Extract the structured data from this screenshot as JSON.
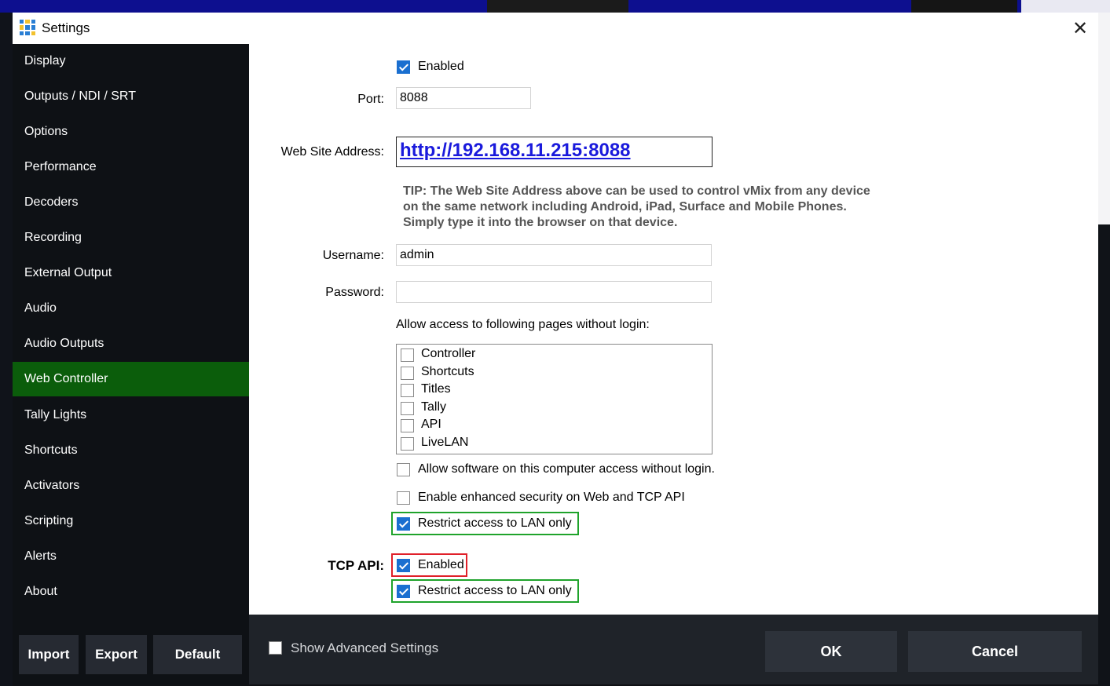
{
  "window": {
    "title": "Settings",
    "close_symbol": "✕"
  },
  "sidebar": {
    "items": [
      {
        "label": "Display"
      },
      {
        "label": "Outputs / NDI / SRT"
      },
      {
        "label": "Options"
      },
      {
        "label": "Performance"
      },
      {
        "label": "Decoders"
      },
      {
        "label": "Recording"
      },
      {
        "label": "External Output"
      },
      {
        "label": "Audio"
      },
      {
        "label": "Audio Outputs"
      },
      {
        "label": "Web Controller",
        "active": true
      },
      {
        "label": "Tally Lights"
      },
      {
        "label": "Shortcuts"
      },
      {
        "label": "Activators"
      },
      {
        "label": "Scripting"
      },
      {
        "label": "Alerts"
      },
      {
        "label": "About"
      }
    ],
    "buttons": {
      "import": "Import",
      "export": "Export",
      "default": "Default"
    }
  },
  "web_controller": {
    "enabled_label": "Enabled",
    "enabled": true,
    "port_label": "Port:",
    "port_value": "8088",
    "website_label": "Web Site Address:",
    "website_url": "http://192.168.11.215:8088",
    "tip_lines": [
      "TIP: The Web Site Address above can be used to control vMix from any device",
      "on the same network including Android, iPad, Surface and Mobile Phones.",
      "Simply type it into the browser on that device."
    ],
    "username_label": "Username:",
    "username_value": "admin",
    "password_label": "Password:",
    "password_value": "",
    "pages_label": "Allow access to following pages without login:",
    "pages": [
      {
        "label": "Controller",
        "checked": false
      },
      {
        "label": "Shortcuts",
        "checked": false
      },
      {
        "label": "Titles",
        "checked": false
      },
      {
        "label": "Tally",
        "checked": false
      },
      {
        "label": "API",
        "checked": false
      },
      {
        "label": "LiveLAN",
        "checked": false
      }
    ],
    "allow_software_label": "Allow software on this computer access without login.",
    "allow_software": false,
    "enhanced_security_label": "Enable enhanced security on Web and TCP API",
    "enhanced_security": false,
    "restrict_lan_label": "Restrict access to LAN only",
    "restrict_lan": true
  },
  "tcp_api": {
    "label": "TCP API:",
    "enabled_label": "Enabled",
    "enabled": true,
    "restrict_lan_label": "Restrict access to LAN only",
    "restrict_lan": true
  },
  "footer": {
    "show_advanced_label": "Show Advanced Settings",
    "show_advanced": false,
    "ok_label": "OK",
    "cancel_label": "Cancel"
  },
  "colors": {
    "sidebar_bg": "#0e1115",
    "active_item": "#0b5d0b",
    "checkbox_checked": "#1a6fd0",
    "highlight_green": "#1fa32b",
    "highlight_red": "#e0202a",
    "link": "#1a1adc"
  }
}
